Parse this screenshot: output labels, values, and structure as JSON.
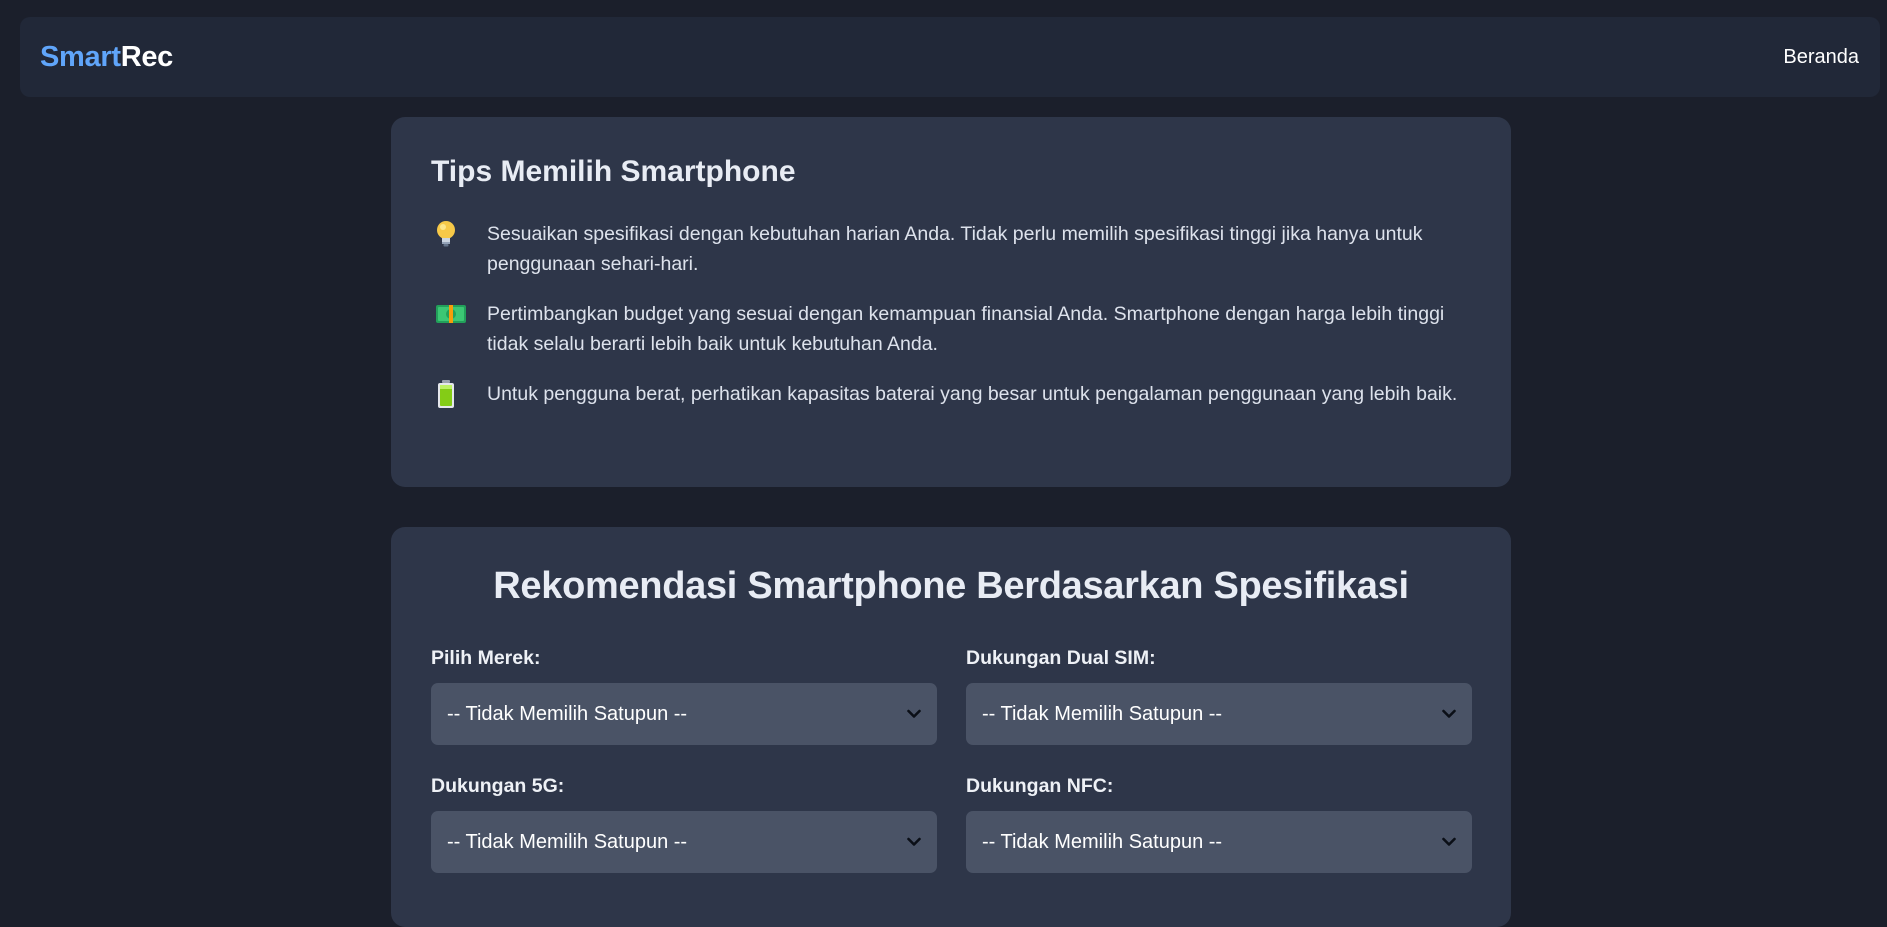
{
  "navbar": {
    "brand_part1": "Smart",
    "brand_part2": "Rec",
    "home_link": "Beranda",
    "brand_colors": {
      "accent": "#60a5fa",
      "text": "#ffffff"
    }
  },
  "tips": {
    "title": "Tips Memilih Smartphone",
    "items": [
      {
        "icon": "lightbulb-icon",
        "text": "Sesuaikan spesifikasi dengan kebutuhan harian Anda. Tidak perlu memilih spesifikasi tinggi jika hanya untuk penggunaan sehari-hari."
      },
      {
        "icon": "money-icon",
        "text": "Pertimbangkan budget yang sesuai dengan kemampuan finansial Anda. Smartphone dengan harga lebih tinggi tidak selalu berarti lebih baik untuk kebutuhan Anda."
      },
      {
        "icon": "battery-icon",
        "text": "Untuk pengguna berat, perhatikan kapasitas baterai yang besar untuk pengalaman penggunaan yang lebih baik."
      }
    ]
  },
  "recommendation": {
    "title": "Rekomendasi Smartphone Berdasarkan Spesifikasi",
    "fields": [
      {
        "label": "Pilih Merek:",
        "value": "-- Tidak Memilih Satupun --"
      },
      {
        "label": "Dukungan Dual SIM:",
        "value": "-- Tidak Memilih Satupun --"
      },
      {
        "label": "Dukungan 5G:",
        "value": "-- Tidak Memilih Satupun --"
      },
      {
        "label": "Dukungan NFC:",
        "value": "-- Tidak Memilih Satupun --"
      }
    ]
  }
}
